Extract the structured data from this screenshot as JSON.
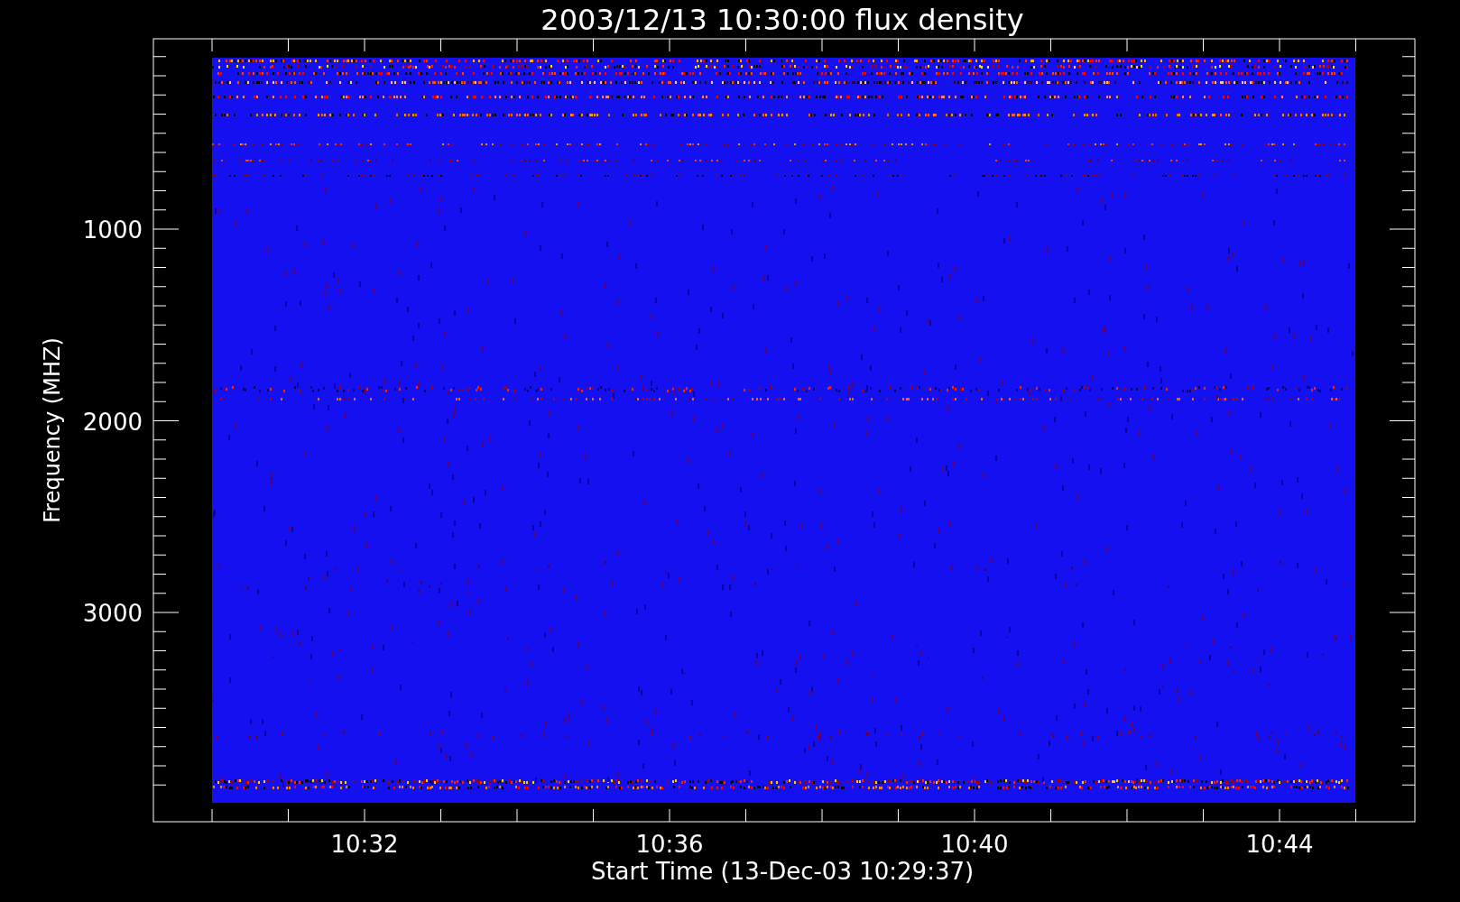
{
  "title": "2003/12/13 10:30:00 flux density",
  "y_axis": {
    "label": "Frequency (MHZ)",
    "ticks": [
      "1000",
      "2000",
      "3000"
    ]
  },
  "x_axis": {
    "label": "Start Time (13-Dec-03 10:29:37)",
    "ticks": [
      "10:32",
      "10:36",
      "10:40",
      "10:44"
    ]
  }
}
